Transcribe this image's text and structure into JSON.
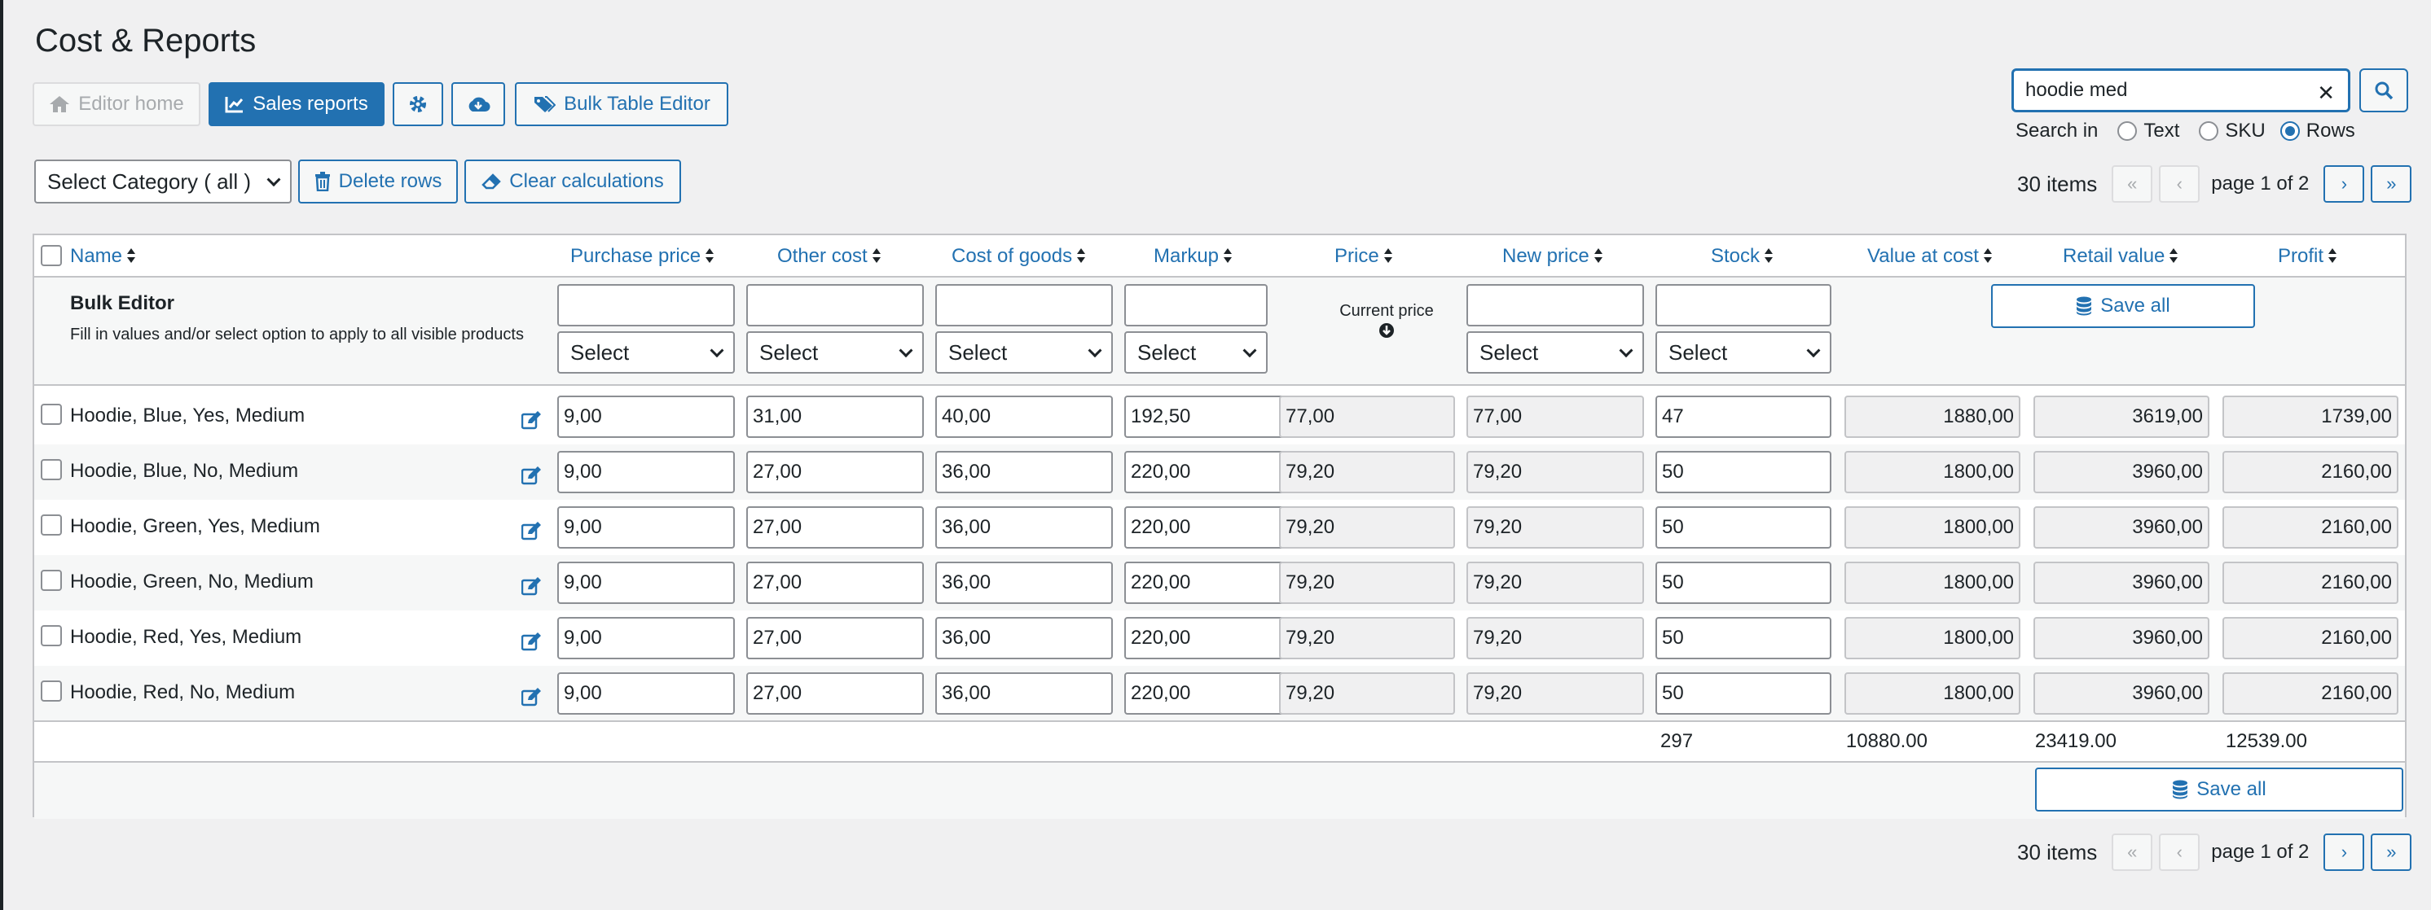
{
  "page": {
    "title": "Cost & Reports"
  },
  "toolbar": {
    "editor_home": "Editor home",
    "sales_reports": "Sales reports",
    "bulk_table_editor": "Bulk Table Editor",
    "select_category": "Select Category ( all )",
    "delete_rows": "Delete rows",
    "clear_calculations": "Clear calculations"
  },
  "search": {
    "value": "hoodie med",
    "search_in_label": "Search in",
    "options": [
      "Text",
      "SKU",
      "Rows"
    ],
    "selected": "Rows"
  },
  "pagination": {
    "items": "30 items",
    "page_text": "page 1 of 2"
  },
  "table": {
    "columns": [
      "Name",
      "Purchase price",
      "Other cost",
      "Cost of goods",
      "Markup",
      "Price",
      "New price",
      "Stock",
      "Value at cost",
      "Retail value",
      "Profit"
    ],
    "bulk_editor": {
      "title": "Bulk Editor",
      "description": "Fill in values and/or select option to apply to all visible products",
      "select_label": "Select",
      "current_price": "Current price",
      "save_all": "Save all"
    },
    "rows": [
      {
        "name": "Hoodie, Blue, Yes, Medium",
        "purchase": "9,00",
        "other": "31,00",
        "cogs": "40,00",
        "markup": "192,50",
        "price": "77,00",
        "new_price": "77,00",
        "stock": "47",
        "value_cost": "1880,00",
        "retail": "3619,00",
        "profit": "1739,00"
      },
      {
        "name": "Hoodie, Blue, No, Medium",
        "purchase": "9,00",
        "other": "27,00",
        "cogs": "36,00",
        "markup": "220,00",
        "price": "79,20",
        "new_price": "79,20",
        "stock": "50",
        "value_cost": "1800,00",
        "retail": "3960,00",
        "profit": "2160,00"
      },
      {
        "name": "Hoodie, Green, Yes, Medium",
        "purchase": "9,00",
        "other": "27,00",
        "cogs": "36,00",
        "markup": "220,00",
        "price": "79,20",
        "new_price": "79,20",
        "stock": "50",
        "value_cost": "1800,00",
        "retail": "3960,00",
        "profit": "2160,00"
      },
      {
        "name": "Hoodie, Green, No, Medium",
        "purchase": "9,00",
        "other": "27,00",
        "cogs": "36,00",
        "markup": "220,00",
        "price": "79,20",
        "new_price": "79,20",
        "stock": "50",
        "value_cost": "1800,00",
        "retail": "3960,00",
        "profit": "2160,00"
      },
      {
        "name": "Hoodie, Red, Yes, Medium",
        "purchase": "9,00",
        "other": "27,00",
        "cogs": "36,00",
        "markup": "220,00",
        "price": "79,20",
        "new_price": "79,20",
        "stock": "50",
        "value_cost": "1800,00",
        "retail": "3960,00",
        "profit": "2160,00"
      },
      {
        "name": "Hoodie, Red, No, Medium",
        "purchase": "9,00",
        "other": "27,00",
        "cogs": "36,00",
        "markup": "220,00",
        "price": "79,20",
        "new_price": "79,20",
        "stock": "50",
        "value_cost": "1800,00",
        "retail": "3960,00",
        "profit": "2160,00"
      }
    ],
    "totals": {
      "stock": "297",
      "value_cost": "10880.00",
      "retail": "23419.00",
      "profit": "12539.00"
    }
  },
  "colors": {
    "accent": "#2271b1",
    "border": "#c3c4c7",
    "background": "#f0f0f1"
  }
}
